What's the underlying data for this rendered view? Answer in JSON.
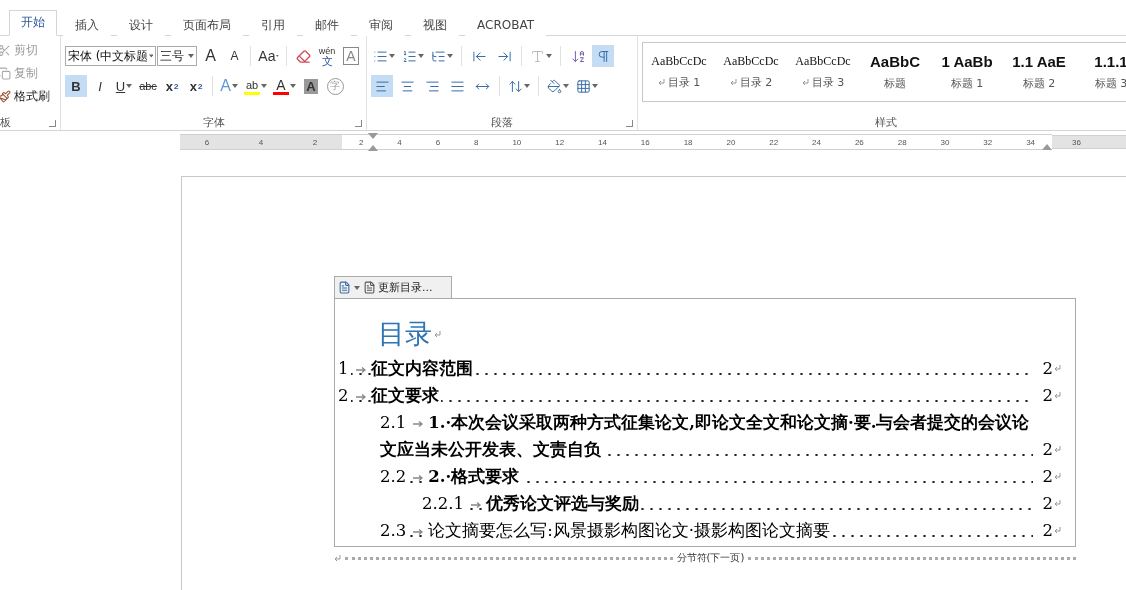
{
  "tabs": [
    {
      "label": "开始",
      "selected": true
    },
    {
      "label": "插入",
      "selected": false
    },
    {
      "label": "设计",
      "selected": false
    },
    {
      "label": "页面布局",
      "selected": false
    },
    {
      "label": "引用",
      "selected": false
    },
    {
      "label": "邮件",
      "selected": false
    },
    {
      "label": "审阅",
      "selected": false
    },
    {
      "label": "视图",
      "selected": false
    },
    {
      "label": "ACROBAT",
      "selected": false
    }
  ],
  "clipboard": {
    "label": "板",
    "items": [
      {
        "kind": "cut",
        "label": "剪切",
        "disabled": true
      },
      {
        "kind": "copy",
        "label": "复制",
        "disabled": true
      },
      {
        "kind": "painter",
        "label": "格式刷",
        "disabled": false
      }
    ]
  },
  "font": {
    "label": "字体",
    "font_name": "宋体 (中文标题",
    "font_size": "三号",
    "row1": [
      {
        "kind": "grow",
        "label": "A"
      },
      {
        "kind": "shrink",
        "label": "A"
      },
      {
        "kind": "case",
        "label": "Aa"
      },
      {
        "kind": "eraser"
      },
      {
        "kind": "phonetic",
        "label": "wén",
        "sub": "文"
      },
      {
        "kind": "boxed",
        "label": "A"
      }
    ],
    "row2": [
      {
        "kind": "bold",
        "label": "B",
        "selected": true
      },
      {
        "kind": "italic",
        "label": "I",
        "selected": false
      },
      {
        "kind": "underline",
        "label": "U",
        "selected": false
      },
      {
        "kind": "strike",
        "label": "abc",
        "selected": false
      },
      {
        "kind": "subscript",
        "label": "x",
        "sub": "2",
        "selected": false
      },
      {
        "kind": "superscript",
        "label": "x",
        "sub": "2",
        "selected": false
      },
      {
        "kind": "effects",
        "label": "A",
        "selected": false
      },
      {
        "kind": "highlight",
        "label": "ab",
        "color": "#ffff00",
        "selected": false
      },
      {
        "kind": "fontcolor",
        "label": "A",
        "color": "#ff0000",
        "selected": false
      },
      {
        "kind": "shaded",
        "label": "A",
        "selected": false
      },
      {
        "kind": "enclosed",
        "label": "字",
        "selected": false
      }
    ]
  },
  "paragraph": {
    "label": "段落",
    "row1": [
      {
        "kind": "bullets",
        "selected": false,
        "disabled": false
      },
      {
        "kind": "numbering",
        "selected": false,
        "disabled": false
      },
      {
        "kind": "multilevel",
        "selected": false,
        "disabled": false
      },
      {
        "kind": "outdent",
        "selected": false,
        "disabled": false
      },
      {
        "kind": "indent",
        "selected": false,
        "disabled": false
      },
      {
        "kind": "asian",
        "selected": false,
        "disabled": true
      },
      {
        "kind": "sort",
        "selected": false,
        "disabled": false
      },
      {
        "kind": "marks",
        "selected": true,
        "disabled": false
      }
    ],
    "row2": [
      {
        "kind": "left",
        "selected": true,
        "disabled": false
      },
      {
        "kind": "center",
        "selected": false,
        "disabled": false
      },
      {
        "kind": "right",
        "selected": false,
        "disabled": false
      },
      {
        "kind": "justify",
        "selected": false,
        "disabled": false
      },
      {
        "kind": "distribute",
        "selected": false,
        "disabled": false
      },
      {
        "kind": "spacing",
        "selected": false,
        "disabled": false
      },
      {
        "kind": "shading",
        "selected": false,
        "disabled": false
      },
      {
        "kind": "borders",
        "selected": false,
        "disabled": false
      }
    ]
  },
  "styles": {
    "label": "样式",
    "items": [
      {
        "kind": "toc",
        "preview": "AaBbCcDc",
        "name": "目录 1"
      },
      {
        "kind": "toc",
        "preview": "AaBbCcDc",
        "name": "目录 2"
      },
      {
        "kind": "toc",
        "preview": "AaBbCcDc",
        "name": "目录 3"
      },
      {
        "kind": "heading",
        "preview": "AaBbC",
        "name": "标题"
      },
      {
        "kind": "heading",
        "preview": "1  AaBb",
        "name": "标题 1"
      },
      {
        "kind": "heading",
        "preview": "1.1  AaE",
        "name": "标题 2"
      },
      {
        "kind": "heading",
        "preview": "1.1.1",
        "name": "标题 3"
      }
    ]
  },
  "ruler": {
    "left_labels": [
      "6",
      "4",
      "2"
    ],
    "labels": [
      "2",
      "4",
      "6",
      "8",
      "10",
      "12",
      "14",
      "16",
      "18",
      "20",
      "22",
      "24",
      "26",
      "28",
      "30",
      "32",
      "34"
    ],
    "right_labels": [
      "36"
    ]
  },
  "toc": {
    "update_label": "更新目录...",
    "title": "目录",
    "entries": [
      {
        "number": "1",
        "title": "征文内容范围",
        "page": "2",
        "bold": true
      },
      {
        "number": "2",
        "title": "征文要求",
        "page": "2",
        "bold": true,
        "children": [
          {
            "number": "2.1",
            "title": "1.·本次会议采取两种方式征集论文,即论文全文和论文摘·要.与会者提交的会议论文应当未公开发表、文责自负",
            "page": "2",
            "bold": true
          },
          {
            "number": "2.2",
            "title": "2.·格式要求",
            "page": "2",
            "bold": true,
            "children": [
              {
                "number": "2.2.1",
                "title": "优秀论文评选与奖励",
                "page": "2",
                "bold": true
              }
            ]
          },
          {
            "number": "2.3",
            "title": "论文摘要怎么写:风景摄影构图论文·摄影构图论文摘要",
            "page": "2",
            "bold": false
          }
        ]
      }
    ]
  },
  "section_break": "分节符(下一页)"
}
